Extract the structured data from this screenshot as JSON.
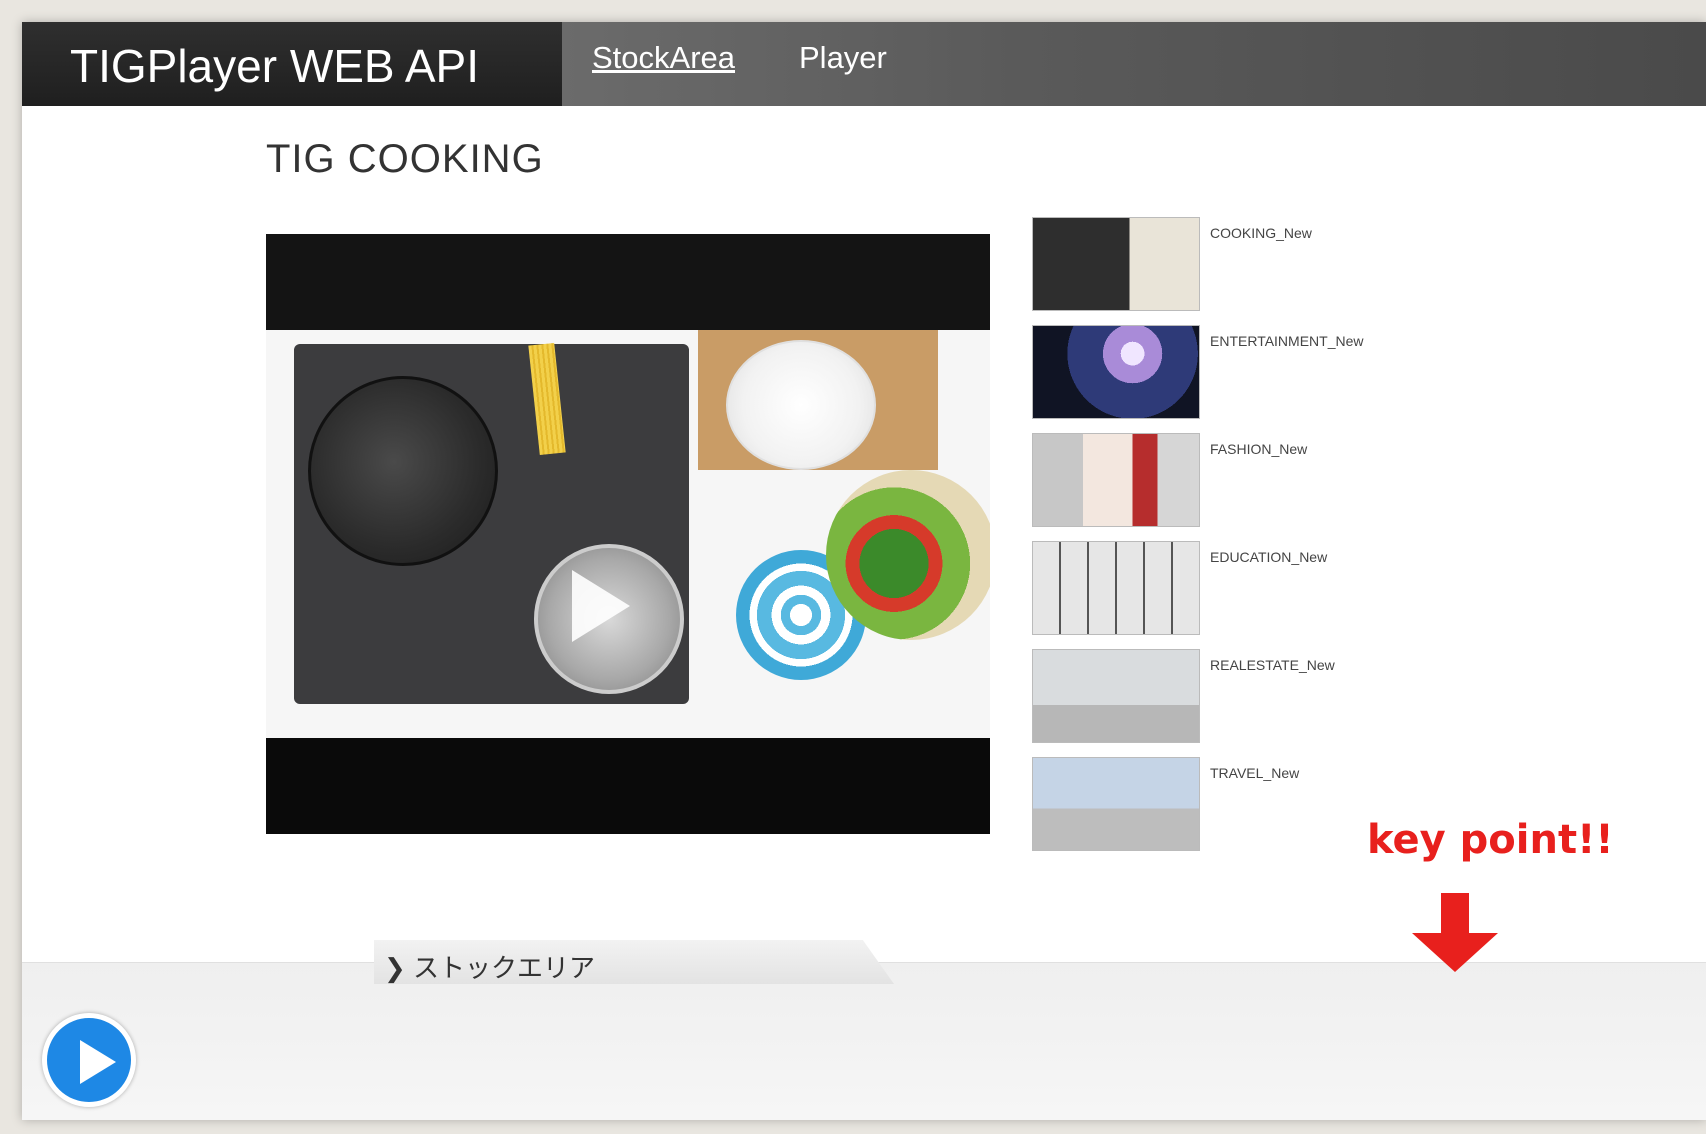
{
  "nav": {
    "brand": "TIGPlayer WEB API",
    "links": [
      "StockArea",
      "Player"
    ]
  },
  "page": {
    "title": "TIG COOKING"
  },
  "playlist": [
    {
      "label": "COOKING_New"
    },
    {
      "label": "ENTERTAINMENT_New"
    },
    {
      "label": "FASHION_New"
    },
    {
      "label": "EDUCATION_New"
    },
    {
      "label": "REALESTATE_New"
    },
    {
      "label": "TRAVEL_New"
    }
  ],
  "annotation": {
    "key_point": "key point!!",
    "color": "#e8201d"
  },
  "stock_area": {
    "tab_label": "ストックエリア",
    "chevron_icon": "chevron-right-icon"
  },
  "floating_player": {
    "icon": "play-icon",
    "color": "#1e88e5"
  },
  "video": {
    "icon": "play-icon"
  }
}
